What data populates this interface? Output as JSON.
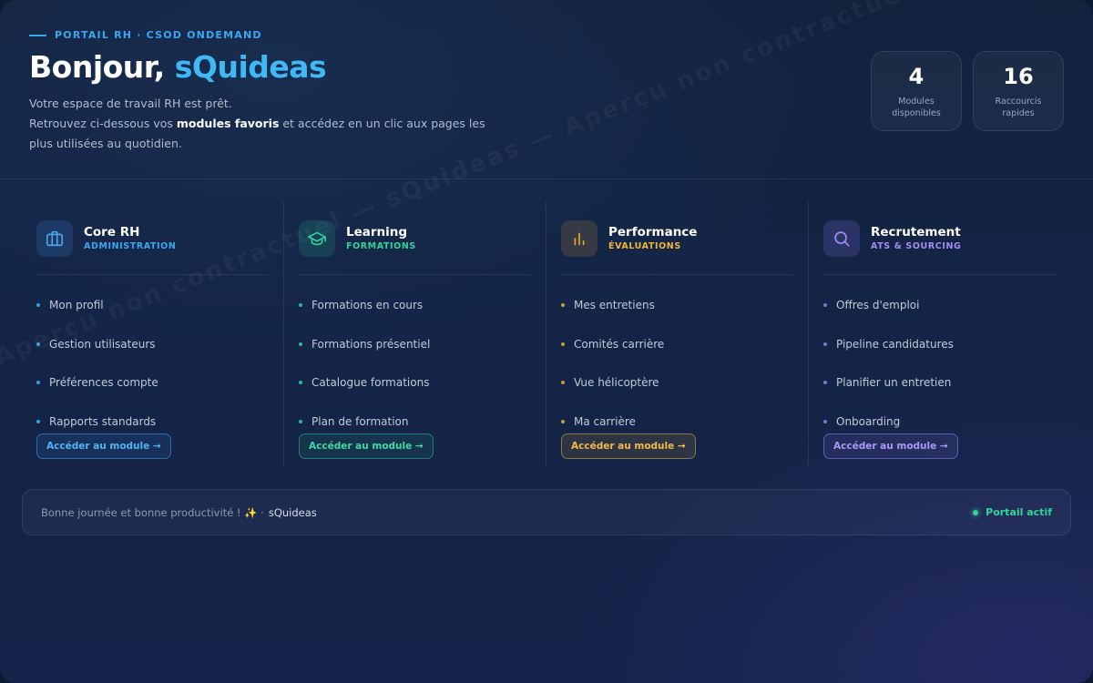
{
  "header": {
    "eyebrow": "PORTAIL RH · CSOD ONDEMAND",
    "greeting": "Bonjour, ",
    "user": "sQuideas",
    "line1": "Votre espace de travail RH est prêt.",
    "line2_pre": "Retrouvez ci-dessous vos ",
    "line2_bold": "modules favoris",
    "line2_post": " et accédez en un clic aux pages les plus utilisées au quotidien."
  },
  "stats": [
    {
      "value": "4",
      "label": "Modules disponibles"
    },
    {
      "value": "16",
      "label": "Raccourcis rapides"
    }
  ],
  "modules": [
    {
      "title": "Core RH",
      "subtitle": "ADMINISTRATION",
      "icon": "briefcase-icon",
      "accent": "#3aa8f0",
      "items": [
        "Mon profil",
        "Gestion utilisateurs",
        "Préférences compte",
        "Rapports standards"
      ],
      "button": "Accéder au module →"
    },
    {
      "title": "Learning",
      "subtitle": "FORMATIONS",
      "icon": "graduation-cap-icon",
      "accent": "#34d39a",
      "items": [
        "Formations en cours",
        "Formations présentiel",
        "Catalogue formations",
        "Plan de formation"
      ],
      "button": "Accéder au module →"
    },
    {
      "title": "Performance",
      "subtitle": "ÉVALUATIONS",
      "icon": "bar-chart-icon",
      "accent": "#f0b43c",
      "items": [
        "Mes entretiens",
        "Comités carrière",
        "Vue hélicoptère",
        "Ma carrière"
      ],
      "button": "Accéder au module →"
    },
    {
      "title": "Recrutement",
      "subtitle": "ATS & SOURCING",
      "icon": "search-icon",
      "accent": "#a68cf5",
      "items": [
        "Offres d'emploi",
        "Pipeline candidatures",
        "Planifier un entretien",
        "Onboarding"
      ],
      "button": "Accéder au module →"
    }
  ],
  "footer": {
    "message": "Bonne journée et bonne productivité ! ✨ ·",
    "signature": "sQuideas",
    "status": "Portail actif"
  },
  "watermark": "Aperçu non contractuel — sQuideas — Aperçu non contractuel — sQuideas — Aperçu non"
}
